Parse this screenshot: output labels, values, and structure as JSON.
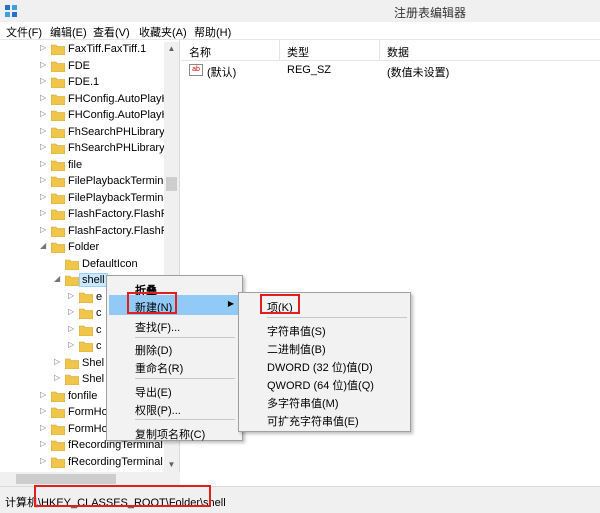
{
  "window": {
    "title": "注册表编辑器"
  },
  "menu": [
    "文件(F)",
    "编辑(E)",
    "查看(V)",
    "收藏夹(A)",
    "帮助(H)"
  ],
  "tree": {
    "items": [
      {
        "label": "FaxTiff.FaxTiff.1",
        "indent": 1,
        "expander": "▷"
      },
      {
        "label": "FDE",
        "indent": 1,
        "expander": "▷"
      },
      {
        "label": "FDE.1",
        "indent": 1,
        "expander": "▷"
      },
      {
        "label": "FHConfig.AutoPlayH",
        "indent": 1,
        "expander": "▷"
      },
      {
        "label": "FHConfig.AutoPlayH",
        "indent": 1,
        "expander": "▷"
      },
      {
        "label": "FhSearchPHLibrary.F",
        "indent": 1,
        "expander": "▷"
      },
      {
        "label": "FhSearchPHLibrary.F",
        "indent": 1,
        "expander": "▷"
      },
      {
        "label": "file",
        "indent": 1,
        "expander": "▷"
      },
      {
        "label": "FilePlaybackTermina",
        "indent": 1,
        "expander": "▷"
      },
      {
        "label": "FilePlaybackTermina",
        "indent": 1,
        "expander": "▷"
      },
      {
        "label": "FlashFactory.FlashFa",
        "indent": 1,
        "expander": "▷"
      },
      {
        "label": "FlashFactory.FlashFa",
        "indent": 1,
        "expander": "▷"
      },
      {
        "label": "Folder",
        "indent": 1,
        "expander": "◢"
      },
      {
        "label": "DefaultIcon",
        "indent": 2,
        "expander": ""
      },
      {
        "label": "shell",
        "indent": 2,
        "expander": "◢",
        "selected": true
      },
      {
        "label": "e",
        "indent": 3,
        "expander": "▷"
      },
      {
        "label": "c",
        "indent": 3,
        "expander": "▷"
      },
      {
        "label": "c",
        "indent": 3,
        "expander": "▷"
      },
      {
        "label": "c",
        "indent": 3,
        "expander": "▷"
      },
      {
        "label": "Shel",
        "indent": 2,
        "expander": "▷"
      },
      {
        "label": "Shel",
        "indent": 2,
        "expander": "▷"
      },
      {
        "label": "fonfile",
        "indent": 1,
        "expander": "▷"
      },
      {
        "label": "FormHo",
        "indent": 1,
        "expander": "▷"
      },
      {
        "label": "FormHo",
        "indent": 1,
        "expander": "▷"
      },
      {
        "label": "fRecordingTerminal",
        "indent": 1,
        "expander": "▷"
      },
      {
        "label": "fRecordingTerminal",
        "indent": 1,
        "expander": "▷"
      }
    ]
  },
  "list": {
    "headers": [
      "名称",
      "类型",
      "数据"
    ],
    "rows": [
      {
        "icon": "ab",
        "name": "(默认)",
        "type": "REG_SZ",
        "data": "(数值未设置)"
      }
    ]
  },
  "context_menu": {
    "items": [
      "折叠",
      "新建(N)",
      "查找(F)...",
      "删除(D)",
      "重命名(R)",
      "导出(E)",
      "权限(P)...",
      "复制项名称(C)"
    ]
  },
  "submenu": {
    "items": [
      "项(K)",
      "字符串值(S)",
      "二进制值(B)",
      "DWORD (32 位)值(D)",
      "QWORD (64 位)值(Q)",
      "多字符串值(M)",
      "可扩充字符串值(E)"
    ]
  },
  "status": {
    "path": "计算机\\HKEY_CLASSES_ROOT\\Folder\\shell"
  },
  "colors": {
    "highlight": "#91c9f7",
    "annotation_red": "#e0201b",
    "folder": "#f0c64a"
  }
}
